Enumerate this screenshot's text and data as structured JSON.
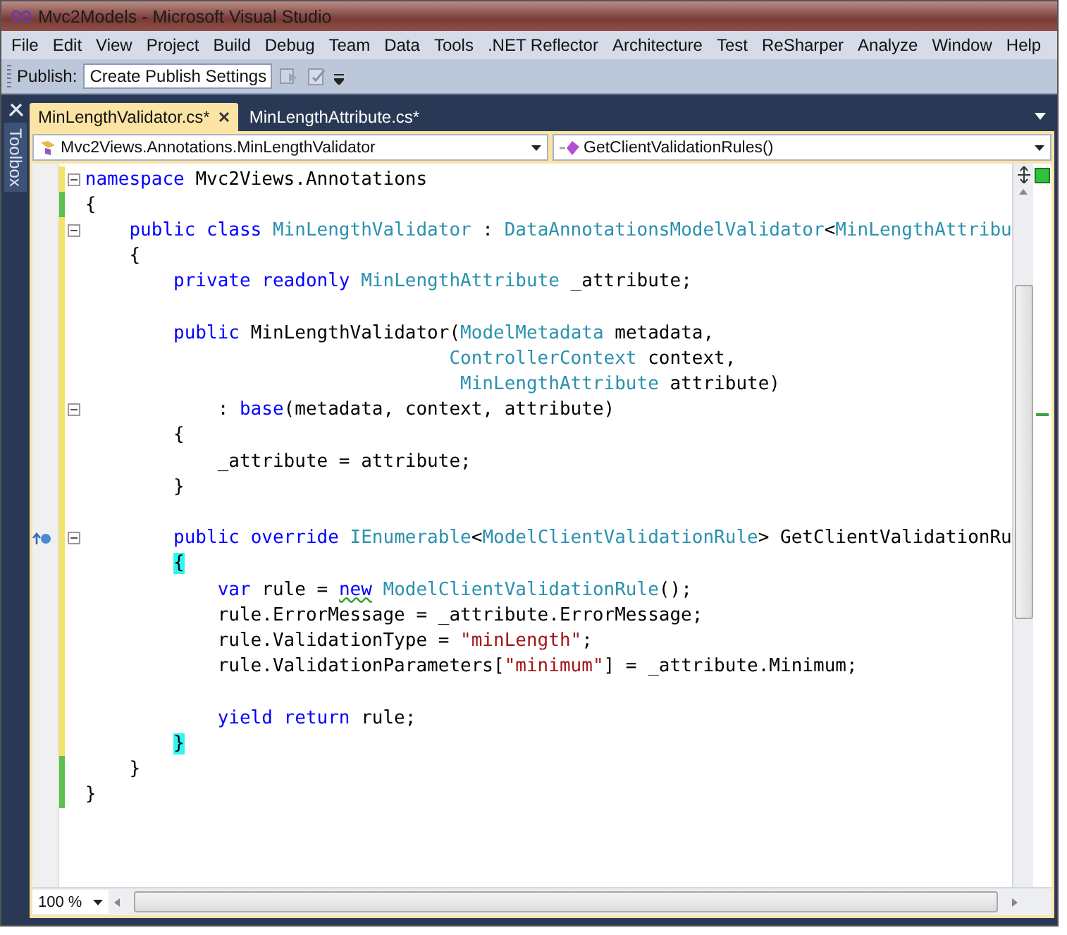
{
  "window": {
    "title": "Mvc2Models - Microsoft Visual Studio"
  },
  "menu": [
    "File",
    "Edit",
    "View",
    "Project",
    "Build",
    "Debug",
    "Team",
    "Data",
    "Tools",
    ".NET Reflector",
    "Architecture",
    "Test",
    "ReSharper",
    "Analyze",
    "Window",
    "Help"
  ],
  "toolbar": {
    "label": "Publish:",
    "dropdown": "Create Publish Settings"
  },
  "side_tab": "Toolbox",
  "tabs": [
    {
      "label": "MinLengthValidator.cs*",
      "selected": true
    },
    {
      "label": "MinLengthAttribute.cs*",
      "selected": false
    }
  ],
  "navigation": {
    "type_dropdown": "Mvc2Views.Annotations.MinLengthValidator",
    "member_dropdown": "GetClientValidationRules()"
  },
  "editor": {
    "lines": [
      {
        "saved": false,
        "fold": true,
        "implements": false,
        "tokens": [
          {
            "kind": "kw",
            "text": "namespace "
          },
          {
            "kind": "text",
            "text": "Mvc2Views.Annotations"
          }
        ]
      },
      {
        "saved": true,
        "fold": false,
        "implements": false,
        "tokens": [
          {
            "kind": "text",
            "text": "{"
          }
        ]
      },
      {
        "saved": false,
        "fold": true,
        "implements": false,
        "tokens": [
          {
            "kind": "kw",
            "text": "    public class "
          },
          {
            "kind": "type",
            "text": "MinLengthValidator"
          },
          {
            "kind": "text",
            "text": " : "
          },
          {
            "kind": "type",
            "text": "DataAnnotationsModelValidator"
          },
          {
            "kind": "text",
            "text": "<"
          },
          {
            "kind": "type",
            "text": "MinLengthAttribu"
          }
        ]
      },
      {
        "saved": false,
        "fold": false,
        "implements": false,
        "tokens": [
          {
            "kind": "text",
            "text": "    {"
          }
        ]
      },
      {
        "saved": false,
        "fold": false,
        "implements": false,
        "tokens": [
          {
            "kind": "kw",
            "text": "        private readonly "
          },
          {
            "kind": "type",
            "text": "MinLengthAttribute"
          },
          {
            "kind": "text",
            "text": " _attribute;"
          }
        ]
      },
      {
        "saved": false,
        "fold": false,
        "implements": false
      },
      {
        "saved": false,
        "fold": false,
        "implements": false,
        "tokens": [
          {
            "kind": "kw",
            "text": "        public"
          },
          {
            "kind": "text",
            "text": " MinLengthValidator("
          },
          {
            "kind": "type",
            "text": "ModelMetadata"
          },
          {
            "kind": "text",
            "text": " metadata,"
          }
        ]
      },
      {
        "saved": false,
        "fold": false,
        "implements": false,
        "tokens": [
          {
            "kind": "type",
            "text": "                                 ControllerContext"
          },
          {
            "kind": "text",
            "text": " context,"
          }
        ]
      },
      {
        "saved": false,
        "fold": false,
        "implements": false,
        "tokens": [
          {
            "kind": "type",
            "text": "                                  MinLengthAttribute"
          },
          {
            "kind": "text",
            "text": " attribute)"
          }
        ]
      },
      {
        "saved": false,
        "fold": true,
        "implements": false,
        "tokens": [
          {
            "kind": "text",
            "text": "            : "
          },
          {
            "kind": "kw",
            "text": "base"
          },
          {
            "kind": "text",
            "text": "(metadata, context, attribute)"
          }
        ]
      },
      {
        "saved": false,
        "fold": false,
        "implements": false,
        "tokens": [
          {
            "kind": "text",
            "text": "        {"
          }
        ]
      },
      {
        "saved": false,
        "fold": false,
        "implements": false,
        "tokens": [
          {
            "kind": "text",
            "text": "            _attribute = attribute;"
          }
        ]
      },
      {
        "saved": false,
        "fold": false,
        "implements": false,
        "tokens": [
          {
            "kind": "text",
            "text": "        }"
          }
        ]
      },
      {
        "saved": false,
        "fold": false,
        "implements": false
      },
      {
        "saved": false,
        "fold": true,
        "implements": true,
        "tokens": [
          {
            "kind": "kw",
            "text": "        public override "
          },
          {
            "kind": "type",
            "text": "IEnumerable"
          },
          {
            "kind": "text",
            "text": "<"
          },
          {
            "kind": "type",
            "text": "ModelClientValidationRule"
          },
          {
            "kind": "text",
            "text": "> GetClientValidationRu"
          }
        ]
      },
      {
        "saved": false,
        "fold": false,
        "implements": false,
        "tokens": [
          {
            "kind": "match",
            "text": "        {"
          }
        ]
      },
      {
        "saved": false,
        "fold": false,
        "implements": false,
        "tokens": [
          {
            "kind": "kw",
            "text": "            var"
          },
          {
            "kind": "text",
            "text": " rule = "
          },
          {
            "kind": "kw-warn",
            "text": "new"
          },
          {
            "kind": "type",
            "text": " ModelClientValidationRule"
          },
          {
            "kind": "text",
            "text": "();"
          }
        ]
      },
      {
        "saved": false,
        "fold": false,
        "implements": false,
        "tokens": [
          {
            "kind": "text",
            "text": "            rule.ErrorMessage = _attribute.ErrorMessage;"
          }
        ]
      },
      {
        "saved": false,
        "fold": false,
        "implements": false,
        "tokens": [
          {
            "kind": "text",
            "text": "            rule.ValidationType = "
          },
          {
            "kind": "str",
            "text": "\"minLength\""
          },
          {
            "kind": "text",
            "text": ";"
          }
        ]
      },
      {
        "saved": false,
        "fold": false,
        "implements": false,
        "tokens": [
          {
            "kind": "text",
            "text": "            rule.ValidationParameters["
          },
          {
            "kind": "str",
            "text": "\"minimum\""
          },
          {
            "kind": "text",
            "text": "] = _attribute.Minimum;"
          }
        ]
      },
      {
        "saved": false,
        "fold": false,
        "implements": false
      },
      {
        "saved": false,
        "fold": false,
        "implements": false,
        "tokens": [
          {
            "kind": "kw",
            "text": "            yield return"
          },
          {
            "kind": "text",
            "text": " rule;"
          }
        ]
      },
      {
        "saved": false,
        "fold": false,
        "implements": false,
        "tokens": [
          {
            "kind": "match",
            "text": "        }"
          }
        ]
      },
      {
        "saved": true,
        "fold": false,
        "implements": false,
        "tokens": [
          {
            "kind": "text",
            "text": "    }"
          }
        ]
      },
      {
        "saved": true,
        "fold": false,
        "implements": false,
        "tokens": [
          {
            "kind": "text",
            "text": "}"
          }
        ]
      }
    ]
  },
  "zoom": "100 %"
}
